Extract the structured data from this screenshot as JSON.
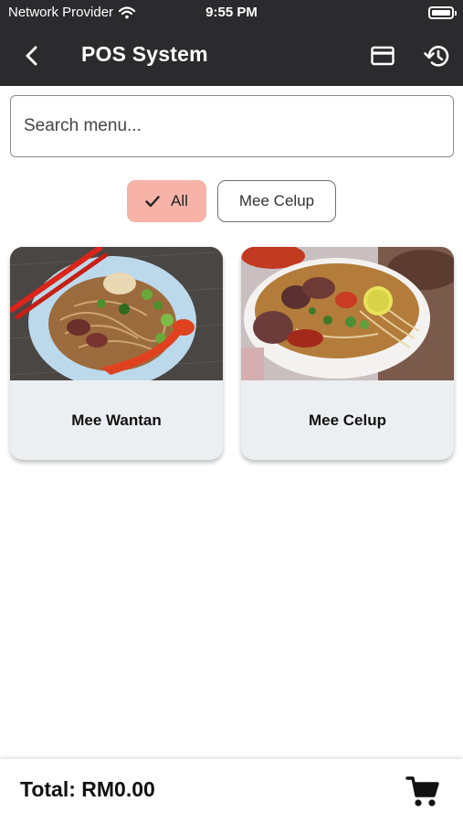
{
  "status_bar": {
    "carrier": "Network Provider",
    "time": "9:55 PM"
  },
  "app_bar": {
    "title": "POS System",
    "icons": {
      "back": "chevron-left-icon",
      "card": "credit-card-icon",
      "history": "history-icon"
    }
  },
  "search": {
    "placeholder": "Search menu...",
    "value": ""
  },
  "filters": [
    {
      "label": "All",
      "selected": true
    },
    {
      "label": "Mee Celup",
      "selected": false
    }
  ],
  "menu_items": [
    {
      "name": "Mee Wantan"
    },
    {
      "name": "Mee Celup"
    }
  ],
  "footer": {
    "total": "Total: RM0.00",
    "cart_icon": "shopping-cart-icon"
  },
  "colors": {
    "app_bar": "#2b2b2e",
    "chip_selected": "#f7b3a8",
    "card_bg": "#eceff1"
  }
}
